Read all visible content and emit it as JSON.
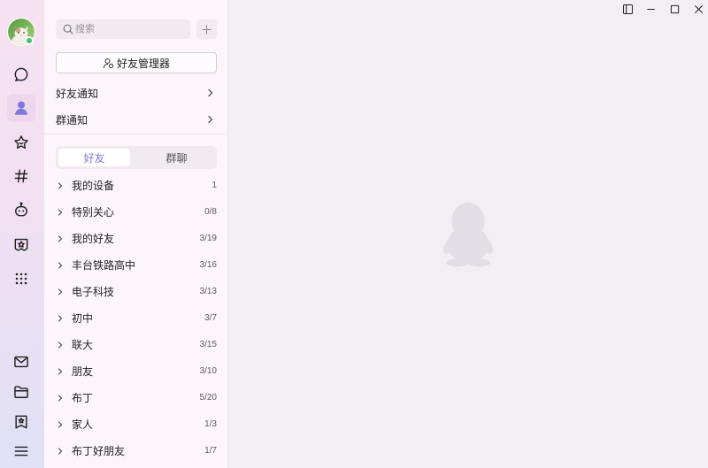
{
  "app": {
    "colors": {
      "accent": "#7d79db",
      "nav_top": "#f6e1f0",
      "nav_bottom": "#e0e0f6",
      "nav_selected_bg": "#eed6ec",
      "panel_bg": "#fcf6fb",
      "main_bg": "#f2eef4",
      "field_bg": "#f1eaf1",
      "online": "#3bc76a",
      "penguin": "#e2dee6"
    }
  },
  "window_controls": [
    {
      "icon": "sidebar-toggle-icon"
    },
    {
      "icon": "minimize-icon"
    },
    {
      "icon": "maximize-icon"
    },
    {
      "icon": "close-icon"
    }
  ],
  "nav": {
    "avatar_icon": "user-avatar",
    "top_items": [
      {
        "icon": "chat-bubble-icon",
        "selected": false
      },
      {
        "icon": "contacts-icon",
        "selected": true
      },
      {
        "icon": "star-icon",
        "selected": false
      },
      {
        "icon": "hash-icon",
        "selected": false
      },
      {
        "icon": "robot-icon",
        "selected": false
      },
      {
        "icon": "game-center-icon",
        "selected": false
      },
      {
        "icon": "grid-apps-icon",
        "selected": false
      }
    ],
    "bottom_items": [
      {
        "icon": "mail-icon"
      },
      {
        "icon": "folder-icon"
      },
      {
        "icon": "favorites-icon"
      },
      {
        "icon": "menu-icon"
      }
    ]
  },
  "contacts": {
    "search": {
      "placeholder": "搜索",
      "icon": "search-icon"
    },
    "add_button_icon": "plus-icon",
    "manager_button": {
      "icon": "friend-manager-icon",
      "label": "好友管理器"
    },
    "notifications": [
      {
        "label": "好友通知"
      },
      {
        "label": "群通知"
      }
    ],
    "tabs": [
      {
        "label": "好友",
        "selected": true
      },
      {
        "label": "群聊",
        "selected": false
      }
    ],
    "groups": [
      {
        "name": "我的设备",
        "count": "1"
      },
      {
        "name": "特别关心",
        "count": "0/8"
      },
      {
        "name": "我的好友",
        "count": "3/19"
      },
      {
        "name": "丰台铁路高中",
        "count": "3/16"
      },
      {
        "name": "电子科技",
        "count": "3/13"
      },
      {
        "name": "初中",
        "count": "3/7"
      },
      {
        "name": "联大",
        "count": "3/15"
      },
      {
        "name": "朋友",
        "count": "3/10"
      },
      {
        "name": "布丁",
        "count": "5/20"
      },
      {
        "name": "家人",
        "count": "1/3"
      },
      {
        "name": "布丁好朋友",
        "count": "1/7"
      }
    ]
  },
  "main": {
    "empty_state_icon": "penguin-icon"
  }
}
